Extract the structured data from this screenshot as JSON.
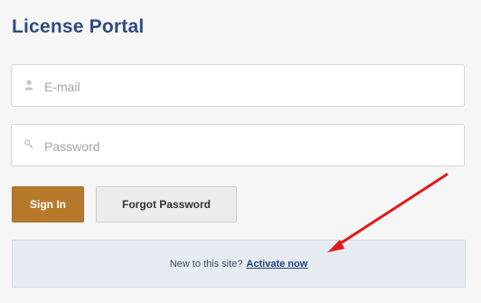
{
  "header": {
    "title": "License Portal"
  },
  "form": {
    "email": {
      "placeholder": "E-mail",
      "value": "",
      "icon": "user-icon"
    },
    "password": {
      "placeholder": "Password",
      "value": "",
      "icon": "key-icon"
    },
    "signin_label": "Sign In",
    "forgot_label": "Forgot Password"
  },
  "footer": {
    "prompt": "New to this site?",
    "link_label": "Activate now"
  },
  "annotation": {
    "arrow_color": "#e01a1a",
    "icon": "arrow-annotation"
  },
  "colors": {
    "title": "#2e4c7f",
    "signin_bg": "#b77a2c",
    "notice_bg": "#e5ebf1",
    "link": "#23407a"
  }
}
